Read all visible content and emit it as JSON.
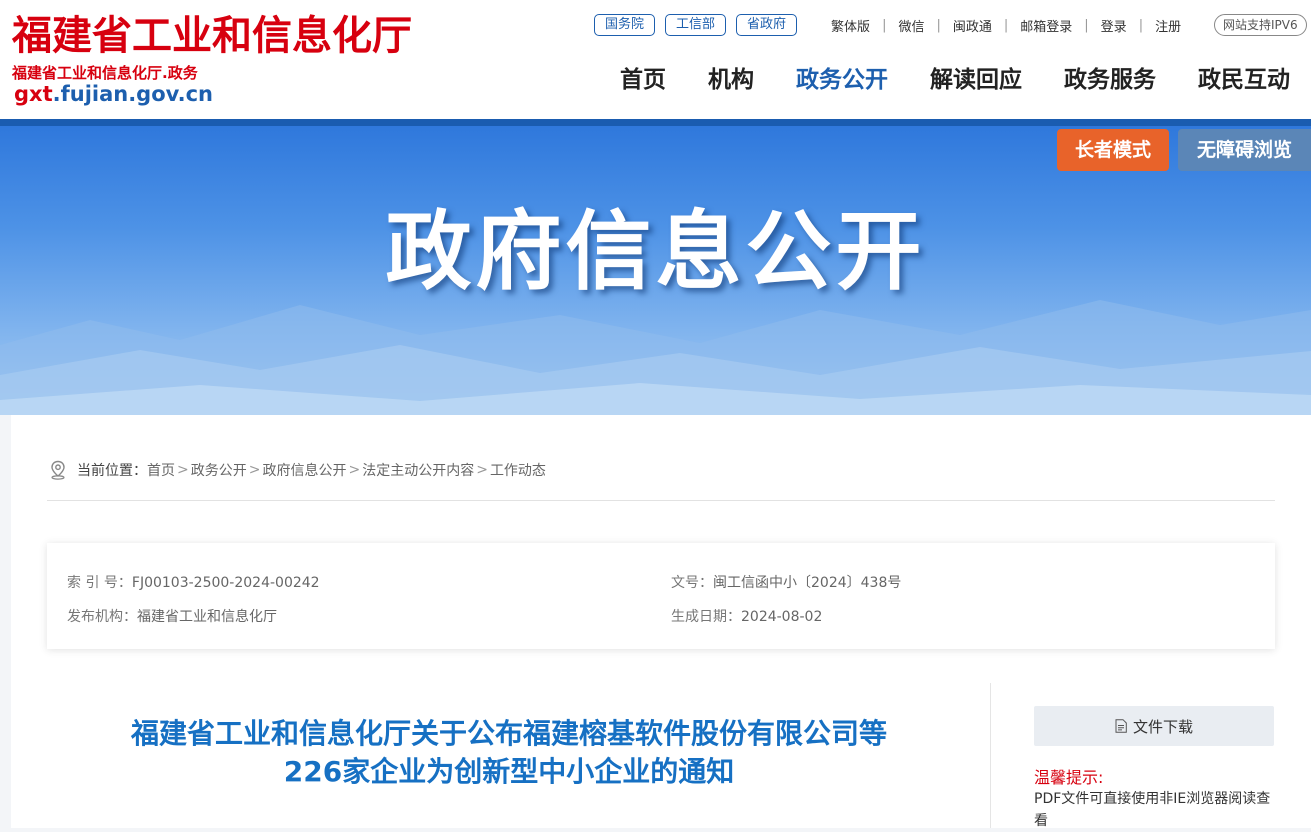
{
  "header": {
    "logo_title": "福建省工业和信息化厅",
    "logo_sub": "福建省工业和信息化厅.政务",
    "domain_highlight": "gxt",
    "domain_rest": ".fujian.gov.cn",
    "pills": [
      "国务院",
      "工信部",
      "省政府"
    ],
    "util_links": [
      "繁体版",
      "微信",
      "闽政通",
      "邮箱登录",
      "登录",
      "注册"
    ],
    "ipv6": "网站支持IPV6",
    "nav": [
      "首页",
      "机构",
      "政务公开",
      "解读回应",
      "政务服务",
      "政民互动"
    ],
    "active_nav": "政务公开"
  },
  "banner": {
    "title": "政府信息公开",
    "elder_mode": "长者模式",
    "accessible": "无障碍浏览"
  },
  "breadcrumb": {
    "label": "当前位置：",
    "items": [
      "首页",
      "政务公开",
      "政府信息公开",
      "法定主动公开内容",
      "工作动态"
    ]
  },
  "meta": {
    "index_label": "索 引 号：",
    "index_value": "FJ00103-2500-2024-00242",
    "doc_no_label": "文号：",
    "doc_no_value": "闽工信函中小〔2024〕438号",
    "publisher_label": "发布机构：",
    "publisher_value": "福建省工业和信息化厅",
    "date_label": "生成日期：",
    "date_value": "2024-08-02"
  },
  "article": {
    "title_line1": "福建省工业和信息化厅关于公布福建榕基软件股份有限公司等",
    "title_line2": "226家企业为创新型中小企业的通知"
  },
  "sidebar": {
    "download": "文件下载",
    "tip_title": "温馨提示:",
    "tip_text": "PDF文件可直接使用非IE浏览器阅读查看"
  },
  "colors": {
    "brand_red": "#d7000f",
    "brand_blue": "#1d5fae",
    "title_blue": "#1670c3",
    "elder_orange": "#e8632a"
  }
}
